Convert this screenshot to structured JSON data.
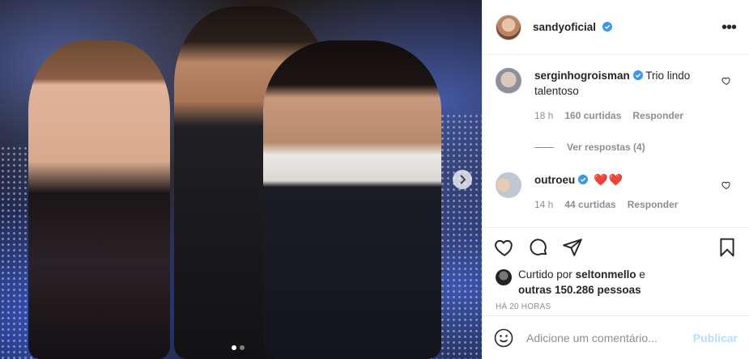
{
  "post_author": {
    "username": "sandyoficial",
    "verified": true
  },
  "colors": {
    "accent_blue": "#0095f6",
    "verified_blue": "#3897f0",
    "heart_red": "#ed4956",
    "muted": "#8e8e8e",
    "publish_disabled": "#b2dffc"
  },
  "photo": {
    "carousel_count": 2,
    "active_index": 0
  },
  "comments": [
    {
      "username": "serginhogroisman",
      "verified": true,
      "text": "Trio lindo talentoso",
      "age": "18 h",
      "likes": "160 curtidas",
      "reply_label": "Responder",
      "view_replies": "Ver respostas (4)"
    },
    {
      "username": "outroeu",
      "verified": true,
      "text": "❤️❤️",
      "age": "14 h",
      "likes": "44 curtidas",
      "reply_label": "Responder"
    }
  ],
  "likes": {
    "prefix": "Curtido por",
    "user": "seltonmello",
    "conjunction": "e",
    "others": "outras 150.286 pessoas"
  },
  "timestamp": "HÁ 20 HORAS",
  "add_comment": {
    "placeholder": "Adicione um comentário...",
    "publish_label": "Publicar"
  },
  "icons": {
    "more": "more-options-icon",
    "like": "heart-icon",
    "comment": "comment-icon",
    "share": "share-icon",
    "save": "bookmark-icon",
    "emoji": "emoji-icon",
    "next": "chevron-right-icon"
  }
}
